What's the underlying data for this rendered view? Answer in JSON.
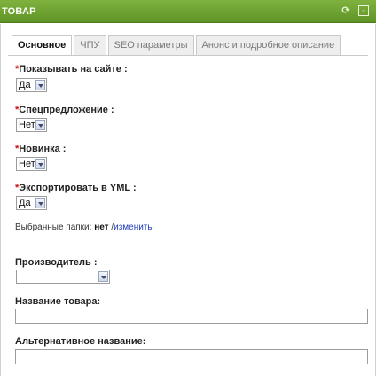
{
  "window": {
    "title": "ТОВАР"
  },
  "tabs": [
    "Основное",
    "ЧПУ",
    "SEO параметры",
    "Анонс и подробное описание"
  ],
  "required_mark": "*",
  "fields": {
    "show_on_site": {
      "label": "Показывать на сайте :",
      "value": "Да"
    },
    "special_offer": {
      "label": "Спецпредложение :",
      "value": "Нет"
    },
    "new_item": {
      "label": "Новинка :",
      "value": "Нет"
    },
    "export_yml": {
      "label": "Экспортировать в YML :",
      "value": "Да"
    },
    "manufacturer": {
      "label": "Производитель :",
      "value": ""
    },
    "product_name": {
      "label": "Название товара:",
      "value": ""
    },
    "alt_name": {
      "label": "Альтернативное название:",
      "value": ""
    }
  },
  "folders": {
    "prefix": "Выбранные папки:",
    "value": "нет",
    "separator": "/",
    "change_link": "изменить"
  },
  "colors": {
    "titlebar": "#6aa02f",
    "required": "#d01010",
    "link": "#1f3fbf"
  }
}
